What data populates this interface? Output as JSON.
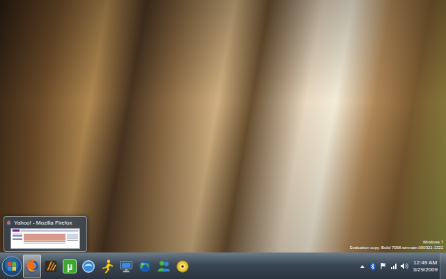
{
  "watermark": {
    "line1": "Windows 7",
    "line2": "Evaluation copy. Build 7068.winmain.090321-1322"
  },
  "thumbnail": {
    "title": "Yahoo! - Mozilla Firefox"
  },
  "taskbar": {
    "items": [
      {
        "kind": "firefox",
        "selected": true
      },
      {
        "kind": "winamp",
        "selected": false
      },
      {
        "kind": "utorrent",
        "glyph": "µ",
        "selected": false
      },
      {
        "kind": "orb",
        "selected": false
      },
      {
        "kind": "aim",
        "selected": false
      },
      {
        "kind": "monitor",
        "selected": false
      },
      {
        "kind": "globe",
        "selected": false
      },
      {
        "kind": "messenger",
        "selected": false
      },
      {
        "kind": "disc",
        "selected": false
      }
    ]
  },
  "tray": {
    "icons": [
      {
        "kind": "arrow"
      },
      {
        "kind": "bluetooth"
      },
      {
        "kind": "flag"
      },
      {
        "kind": "network"
      },
      {
        "kind": "volume"
      }
    ]
  },
  "clock": {
    "time": "12:49 AM",
    "date": "3/29/2009"
  }
}
